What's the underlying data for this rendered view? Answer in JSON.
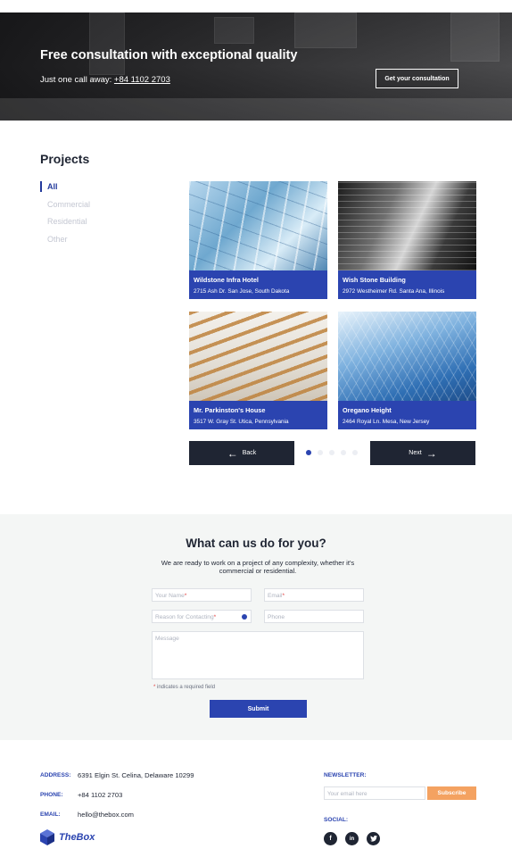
{
  "hero": {
    "title": "Free consultation with exceptional quality",
    "subtitle_prefix": "Just one call away: ",
    "phone": "+84 1102 2703",
    "cta": "Get your consultation"
  },
  "projects": {
    "title": "Projects",
    "filters": [
      "All",
      "Commercial",
      "Residential",
      "Other"
    ],
    "active_filter": "All",
    "items": [
      {
        "name": "Wildstone Infra Hotel",
        "address": "2715 Ash Dr. San Jose, South Dakota",
        "image": "glass-facade-image"
      },
      {
        "name": "Wish Stone Building",
        "address": "2972 Westheimer Rd. Santa Ana, Illinois",
        "image": "tower-image"
      },
      {
        "name": "Mr. Parkinston's House",
        "address": "3517 W. Gray St. Utica, Pennsylvania",
        "image": "staircase-image"
      },
      {
        "name": "Oregano Height",
        "address": "2464 Royal Ln. Mesa, New Jersey",
        "image": "skyscraper-image"
      }
    ],
    "back_label": "Back",
    "next_label": "Next",
    "page_count": 5,
    "current_page": 1
  },
  "contact": {
    "title": "What can us do for you?",
    "subtitle": "We are ready to work on a project of any complexity, whether it's commercial or residential.",
    "name_placeholder": "Your Name",
    "email_placeholder": "Email",
    "reason_placeholder": "Reason for Contacting",
    "phone_placeholder": "Phone",
    "message_placeholder": "Message",
    "required_mark": "*",
    "required_note": "indicates a required field",
    "submit_label": "Submit"
  },
  "footer": {
    "address_label": "ADDRESS:",
    "address": "6391 Elgin St. Celina, Delaware 10299",
    "phone_label": "PHONE:",
    "phone": "+84 1102 2703",
    "email_label": "EMAIL:",
    "email": "hello@thebox.com",
    "brand": "TheBox",
    "newsletter_label": "NEWSLETTER:",
    "newsletter_placeholder": "Your email here",
    "subscribe_label": "Subscribe",
    "social_label": "SOCIAL:",
    "social": [
      "facebook-icon",
      "linkedin-icon",
      "twitter-icon"
    ]
  },
  "colors": {
    "accent": "#2b44b0",
    "dark": "#1f2533",
    "subscribe": "#f4a261",
    "required": "#e23b3b"
  }
}
